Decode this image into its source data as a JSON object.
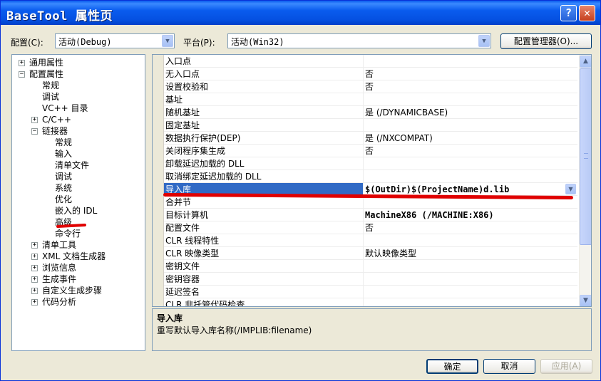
{
  "window": {
    "title": "BaseTool 属性页",
    "help_glyph": "?",
    "close_glyph": "✕"
  },
  "toolbar": {
    "config_label": "配置(C):",
    "config_value": "活动(Debug)",
    "platform_label": "平台(P):",
    "platform_value": "活动(Win32)",
    "config_manager_button": "配置管理器(O)..."
  },
  "tree": [
    {
      "label": "通用属性",
      "indent": 0,
      "expander": "+"
    },
    {
      "label": "配置属性",
      "indent": 0,
      "expander": "−"
    },
    {
      "label": "常规",
      "indent": 1,
      "expander": ""
    },
    {
      "label": "调试",
      "indent": 1,
      "expander": ""
    },
    {
      "label": "VC++ 目录",
      "indent": 1,
      "expander": ""
    },
    {
      "label": "C/C++",
      "indent": 1,
      "expander": "+"
    },
    {
      "label": "链接器",
      "indent": 1,
      "expander": "−"
    },
    {
      "label": "常规",
      "indent": 2,
      "expander": ""
    },
    {
      "label": "输入",
      "indent": 2,
      "expander": ""
    },
    {
      "label": "清单文件",
      "indent": 2,
      "expander": ""
    },
    {
      "label": "调试",
      "indent": 2,
      "expander": ""
    },
    {
      "label": "系统",
      "indent": 2,
      "expander": ""
    },
    {
      "label": "优化",
      "indent": 2,
      "expander": ""
    },
    {
      "label": "嵌入的 IDL",
      "indent": 2,
      "expander": ""
    },
    {
      "label": "高级",
      "indent": 2,
      "expander": ""
    },
    {
      "label": "命令行",
      "indent": 2,
      "expander": ""
    },
    {
      "label": "清单工具",
      "indent": 1,
      "expander": "+"
    },
    {
      "label": "XML 文档生成器",
      "indent": 1,
      "expander": "+"
    },
    {
      "label": "浏览信息",
      "indent": 1,
      "expander": "+"
    },
    {
      "label": "生成事件",
      "indent": 1,
      "expander": "+"
    },
    {
      "label": "自定义生成步骤",
      "indent": 1,
      "expander": "+"
    },
    {
      "label": "代码分析",
      "indent": 1,
      "expander": "+"
    }
  ],
  "properties": [
    {
      "name": "入口点",
      "value": ""
    },
    {
      "name": "无入口点",
      "value": "否"
    },
    {
      "name": "设置校验和",
      "value": "否"
    },
    {
      "name": "基址",
      "value": ""
    },
    {
      "name": "随机基址",
      "value": "是 (/DYNAMICBASE)"
    },
    {
      "name": "固定基址",
      "value": ""
    },
    {
      "name": "数据执行保护(DEP)",
      "value": "是 (/NXCOMPAT)"
    },
    {
      "name": "关闭程序集生成",
      "value": "否"
    },
    {
      "name": "卸载延迟加载的 DLL",
      "value": ""
    },
    {
      "name": "取消绑定延迟加载的 DLL",
      "value": ""
    },
    {
      "name": "导入库",
      "value": "$(OutDir)$(ProjectName)d.lib"
    },
    {
      "name": "合并节",
      "value": ""
    },
    {
      "name": "目标计算机",
      "value": "MachineX86 (/MACHINE:X86)"
    },
    {
      "name": "配置文件",
      "value": "否"
    },
    {
      "name": "CLR 线程特性",
      "value": ""
    },
    {
      "name": "CLR 映像类型",
      "value": "默认映像类型"
    },
    {
      "name": "密钥文件",
      "value": ""
    },
    {
      "name": "密钥容器",
      "value": ""
    },
    {
      "name": "延迟签名",
      "value": ""
    },
    {
      "name": "CLR 非托管代码检查",
      "value": ""
    }
  ],
  "description": {
    "title": "导入库",
    "text": "重写默认导入库名称(/IMPLIB:filename)"
  },
  "buttons": {
    "ok": "确定",
    "cancel": "取消",
    "apply": "应用(A)"
  },
  "icons": {
    "dropdown": "chevron-down-icon",
    "scroll_up": "arrow-up-icon",
    "scroll_down": "arrow-down-icon"
  },
  "colors": {
    "selection": "#316AC5",
    "annotation_red": "#E00000",
    "titlebar": "#0A5CEE"
  }
}
